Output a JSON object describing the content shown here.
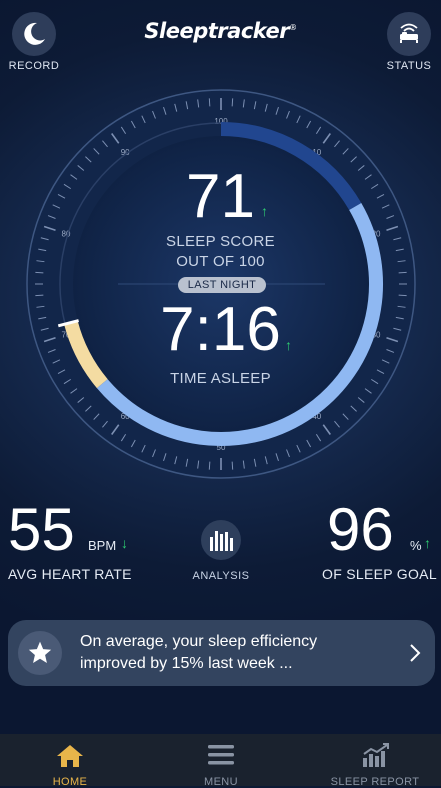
{
  "header": {
    "logo_text": "Sleeptracker",
    "logo_mark": "®",
    "record_label": "RECORD",
    "status_label": "STATUS"
  },
  "dial": {
    "tick_labels": [
      "100",
      "10",
      "20",
      "30",
      "40",
      "50",
      "60",
      "70",
      "80",
      "90"
    ],
    "score_value": "71",
    "score_label": "SLEEP SCORE",
    "score_sublabel": "OUT OF 100",
    "score_fraction": 0.71,
    "period_label": "LAST NIGHT",
    "time_value": "7:16",
    "time_label": "TIME ASLEEP",
    "colors": {
      "light_sleep": "#8fb8f2",
      "deep_sleep": "#21468f",
      "awake": "#f4dca2",
      "trend_up": "#2ecc71"
    }
  },
  "stats": {
    "heart_rate_value": "55",
    "heart_rate_unit": "BPM",
    "heart_rate_label": "AVG HEART RATE",
    "analysis_label": "ANALYSIS",
    "goal_value": "96",
    "goal_unit": "%",
    "goal_label": "OF SLEEP GOAL"
  },
  "insight": {
    "text_line1": "On average, your sleep efficiency",
    "text_line2": "improved by 15% last week ..."
  },
  "tabs": [
    {
      "label": "HOME",
      "icon": "home-icon",
      "active": true
    },
    {
      "label": "MENU",
      "icon": "menu-icon",
      "active": false
    },
    {
      "label": "SLEEP REPORT",
      "icon": "sleep-report-icon",
      "active": false
    }
  ]
}
